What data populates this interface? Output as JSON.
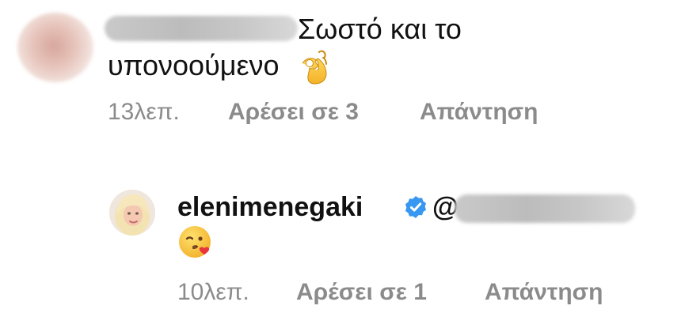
{
  "comments": [
    {
      "text_line_1": "Σωστό και το",
      "text_line_2": "υπονοούμενο",
      "emoji": "ok-hand",
      "time": "13λεπ.",
      "likes": "Αρέσει σε 3",
      "reply": "Απάντηση"
    },
    {
      "username": "elenimenegaki",
      "mention_prefix": "@",
      "emoji": "face-blowing-kiss",
      "time": "10λεπ.",
      "likes": "Αρέσει σε 1",
      "reply": "Απάντηση"
    }
  ],
  "colors": {
    "text": "#111111",
    "meta": "#8b8b8b",
    "verified": "#3897f0"
  }
}
